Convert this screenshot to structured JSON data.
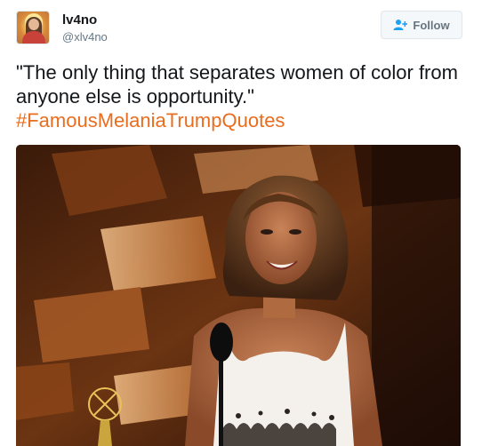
{
  "user": {
    "display_name": "lv4no",
    "handle": "@xlv4no"
  },
  "follow_button": {
    "label": "Follow",
    "icon": "add-user-icon"
  },
  "tweet": {
    "text": "\"The only thing that separates women of color from anyone else is opportunity.\"",
    "hashtag": "#FamousMelaniaTrumpQuotes"
  },
  "colors": {
    "hashtag": "#e86d1f",
    "follow_icon": "#1da1f2",
    "handle": "#657786"
  }
}
